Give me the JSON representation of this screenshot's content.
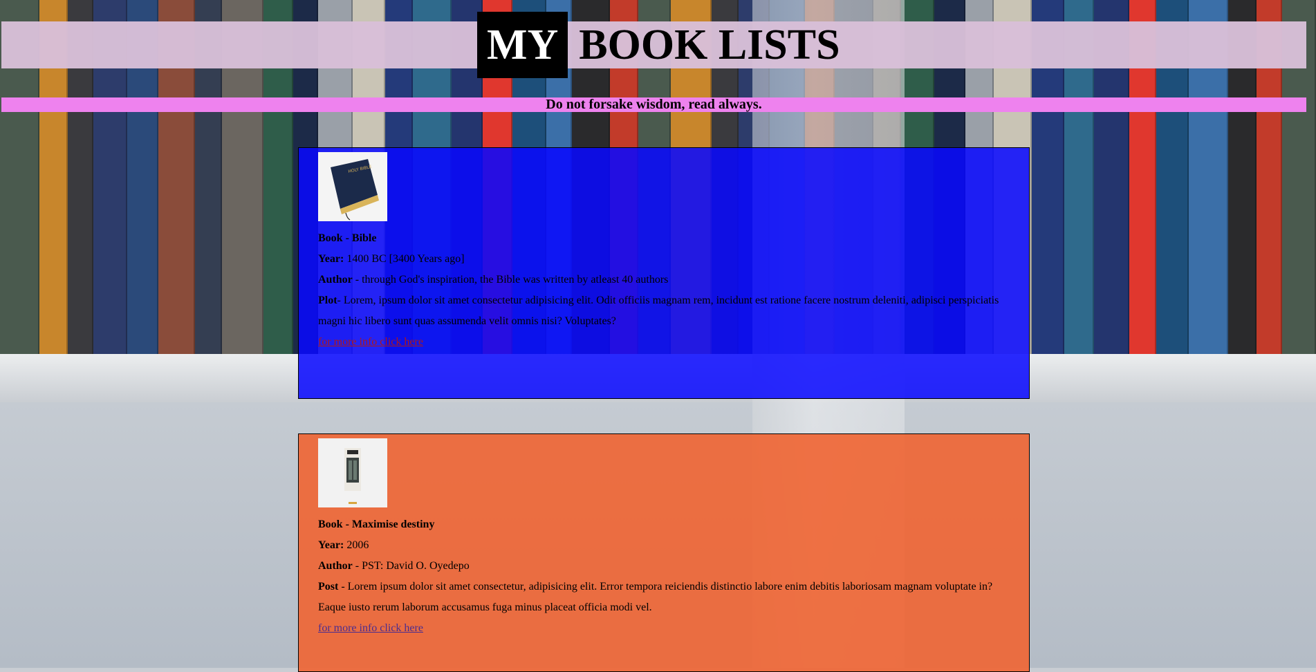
{
  "header": {
    "title_prefix": "MY",
    "title_rest": "BOOK LISTS",
    "tagline": "Do not forsake wisdom, read always."
  },
  "books": [
    {
      "cover_icon": "bible-cover-image",
      "book_label": "Book - Bible",
      "year_label": "Year:",
      "year_value": "1400 BC [3400 Years ago]",
      "author_label": "Author",
      "author_value": " - through God's inspiration, the Bible was written by atleast 40 authors",
      "plot_label": "Plot",
      "plot_value": "- Lorem, ipsum dolor sit amet consectetur adipisicing elit. Odit officiis magnam rem, incidunt est ratione facere nostrum deleniti, adipisci perspiciatis magni hic libero sunt quas assumenda velit omnis nisi? Voluptates?",
      "link_text": "for more info click here",
      "color": "#0808ff"
    },
    {
      "cover_icon": "maximise-destiny-cover-image",
      "book_label": "Book - Maximise destiny",
      "year_label": "Year:",
      "year_value": "2006",
      "author_label": "Author",
      "author_value": " - PST: David O. Oyedepo",
      "plot_label": "Post",
      "plot_value": " - Lorem ipsum dolor sit amet consectetur, adipisicing elit. Error tempora reiciendis distinctio labore enim debitis laboriosam magnam voluptate in? Eaque iusto rerum laborum accusamus fuga minus placeat officia modi vel.",
      "link_text": "for more info click here",
      "color": "#f06432"
    }
  ],
  "colors": {
    "header_bg": "#d8bfd8",
    "tagline_bg": "#ee82ee"
  }
}
